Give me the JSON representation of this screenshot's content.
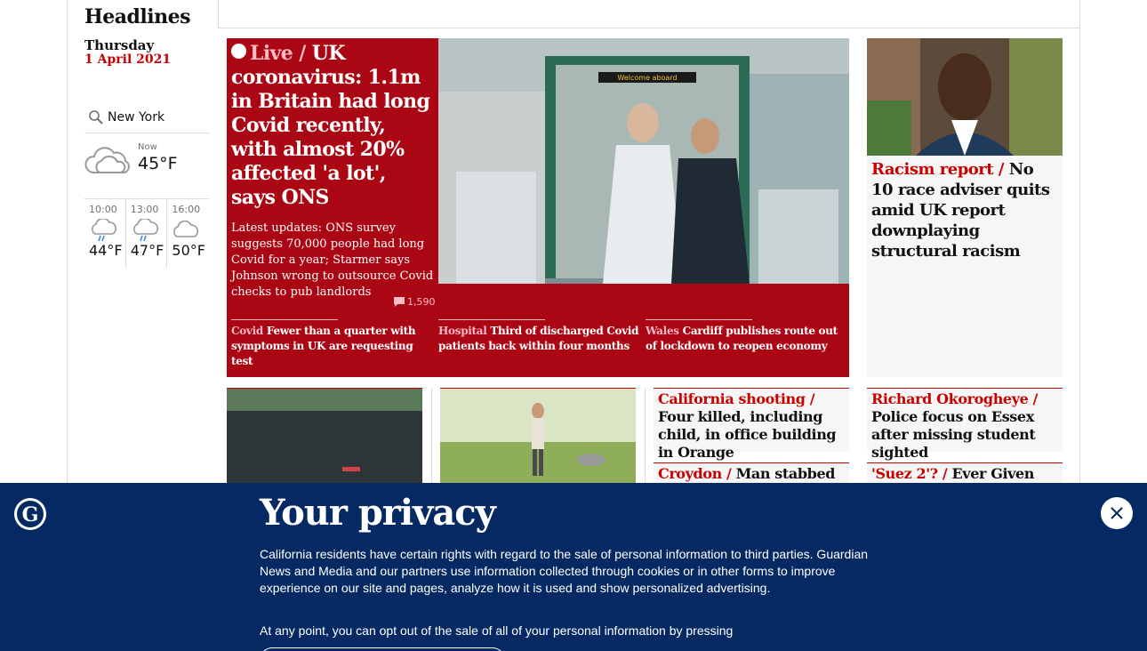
{
  "section": {
    "title": "Headlines"
  },
  "dateline": {
    "day": "Thursday",
    "date": "1 April 2021"
  },
  "weather": {
    "location": "New York",
    "now_label": "Now",
    "now_temp": "45°F",
    "forecast": [
      {
        "time": "10:00",
        "temp": "44°F",
        "icon": "rain-cloud-icon"
      },
      {
        "time": "13:00",
        "temp": "47°F",
        "icon": "rain-cloud-icon"
      },
      {
        "time": "16:00",
        "temp": "50°F",
        "icon": "cloud-icon"
      }
    ]
  },
  "main_story": {
    "kicker": "Live /",
    "headline": "UK coronavirus: 1.1m in Britain had long Covid recently, with almost 20% affected 'a lot', says ONS",
    "standfirst": "Latest updates: ONS survey suggests 70,000 people had long Covid for a year; Starmer says Johnson wrong to outsource Covid checks to pub landlords",
    "comments": "1,590",
    "photo_sign": "Welcome aboard",
    "sublinks": [
      {
        "kicker": "Covid",
        "text": "Fewer than a quarter with symptoms in UK are requesting test"
      },
      {
        "kicker": "Hospital",
        "text": "Third of discharged Covid patients back within four months"
      },
      {
        "kicker": "Wales",
        "text": "Cardiff publishes route out of lockdown to reopen economy"
      }
    ]
  },
  "right_story": {
    "kicker": "Racism report /",
    "headline": "No 10 race adviser quits amid UK report downplaying structural racism"
  },
  "small_cards": [
    {
      "kicker": "California shooting /",
      "headline": "Four killed, including child, in office building in Orange"
    },
    {
      "kicker": "Richard Okorogheye /",
      "headline": "Police focus on Essex after missing student sighted"
    },
    {
      "kicker": "Croydon /",
      "headline": "Man stabbed to"
    },
    {
      "kicker": "'Suez 2'? /",
      "headline": "Ever Given"
    }
  ],
  "privacy": {
    "title": "Your privacy",
    "body": "California residents have certain rights with regard to the sale of personal information to third parties. Guardian News and Media and our partners use information collected through cookies or in other forms to improve experience on our site and pages, analyze how it is used and show personalized advertising.",
    "body2": "At any point, you can opt out of the sale of all of your personal information by pressing"
  },
  "colors": {
    "brand_blue": "#052962",
    "news_red": "#c70000",
    "live_red": "#ab0613",
    "kicker_pink": "#ffbac8"
  }
}
